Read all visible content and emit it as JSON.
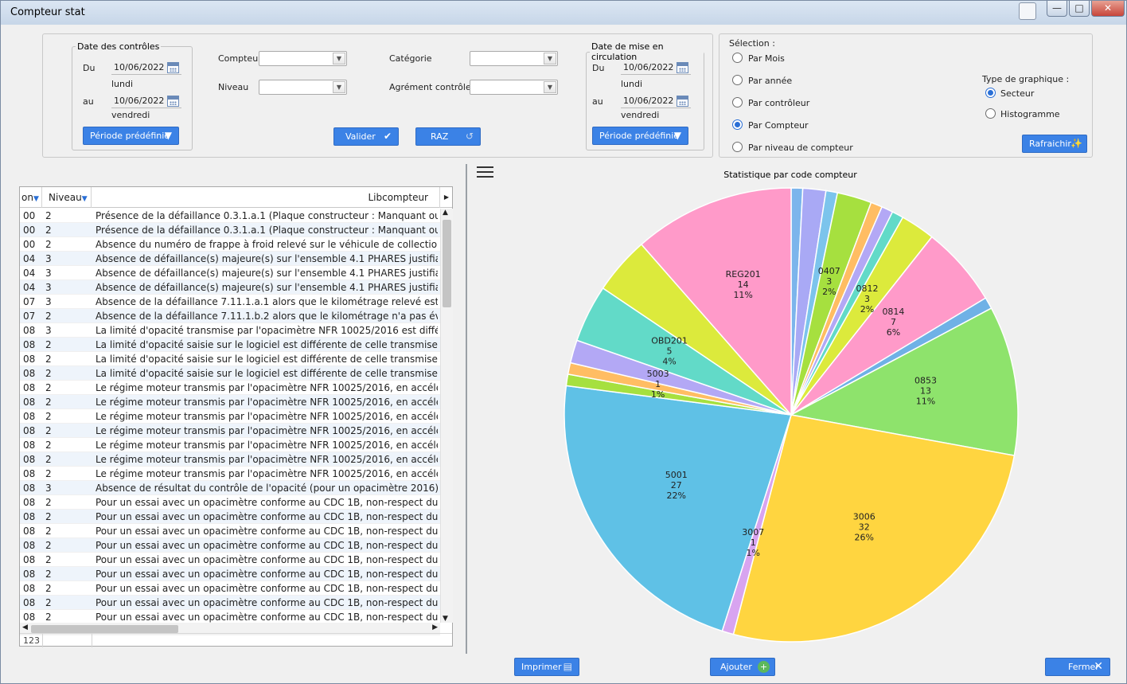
{
  "window": {
    "title": "Compteur stat",
    "controls": {
      "minimize": "—",
      "maximize": "□",
      "close": "✕"
    }
  },
  "filters": {
    "date_controles": {
      "legend": "Date des contrôles",
      "du_label": "Du",
      "du_value": "10/06/2022",
      "du_day": "lundi",
      "au_label": "au",
      "au_value": "10/06/2022",
      "au_day": "vendredi",
      "periode_button": "Période prédéfinie"
    },
    "compteur_label": "Compteur",
    "compteur_value": "",
    "niveau_label": "Niveau",
    "niveau_value": "",
    "categorie_label": "Catégorie",
    "categorie_value": "",
    "agrement_label": "Agrément contrôleur",
    "agrement_value": "",
    "valider_button": "Valider",
    "raz_button": "RAZ",
    "date_circulation": {
      "legend": "Date de mise en circulation",
      "du_label": "Du",
      "du_value": "10/06/2022",
      "du_day": "lundi",
      "au_label": "au",
      "au_value": "10/06/2022",
      "au_day": "vendredi",
      "periode_button": "Période prédéfinie"
    }
  },
  "selection": {
    "label": "Sélection  :",
    "options": [
      "Par Mois",
      "Par année",
      "Par contrôleur",
      "Par Compteur",
      "Par niveau de compteur"
    ],
    "selected": "Par Compteur",
    "chart_type_label": "Type de graphique :",
    "chart_types": [
      "Secteur",
      "Histogramme"
    ],
    "chart_type_selected": "Secteur",
    "refresh_button": "Rafraichir"
  },
  "grid": {
    "columns": [
      "on",
      "Niveau",
      "Libcompteur"
    ],
    "rows": [
      [
        "00",
        "2",
        "Présence de la défaillance 0.3.1.a.1 (Plaque constructeur : Manquant ou"
      ],
      [
        "00",
        "2",
        "Présence de la défaillance 0.3.1.a.1 (Plaque constructeur : Manquant ou"
      ],
      [
        "00",
        "2",
        "Absence du numéro de frappe à froid relevé sur le véhicule de collection e"
      ],
      [
        "04",
        "3",
        "Absence de défaillance(s) majeure(s) sur l'ensemble 4.1 PHARES justifian"
      ],
      [
        "04",
        "3",
        "Absence de défaillance(s) majeure(s) sur l'ensemble 4.1 PHARES justifian"
      ],
      [
        "04",
        "3",
        "Absence de défaillance(s) majeure(s) sur l'ensemble 4.1 PHARES justifian"
      ],
      [
        "07",
        "3",
        "Absence de la défaillance 7.11.1.a.1 alors que le kilométrage relevé est i"
      ],
      [
        "07",
        "2",
        "Absence de la défaillance 7.11.1.b.2 alors que le kilométrage n'a pas évol"
      ],
      [
        "08",
        "3",
        "La limité d'opacité transmise par l'opacimètre NFR 10025/2016 est différe"
      ],
      [
        "08",
        "2",
        "La limité d'opacité saisie sur le logiciel est différente de celle transmise p"
      ],
      [
        "08",
        "2",
        "La limité d'opacité saisie sur le logiciel est différente de celle transmise p"
      ],
      [
        "08",
        "2",
        "La limité d'opacité saisie sur le logiciel est différente de celle transmise p"
      ],
      [
        "08",
        "2",
        "Le régime moteur transmis par l'opacimètre NFR 10025/2016, en accéléra"
      ],
      [
        "08",
        "2",
        "Le régime moteur transmis par l'opacimètre NFR 10025/2016, en accéléra"
      ],
      [
        "08",
        "2",
        "Le régime moteur transmis par l'opacimètre NFR 10025/2016, en accéléra"
      ],
      [
        "08",
        "2",
        "Le régime moteur transmis par l'opacimètre NFR 10025/2016, en accéléra"
      ],
      [
        "08",
        "2",
        "Le régime moteur transmis par l'opacimètre NFR 10025/2016, en accéléra"
      ],
      [
        "08",
        "2",
        "Le régime moteur transmis par l'opacimètre NFR 10025/2016, en accéléra"
      ],
      [
        "08",
        "2",
        "Le régime moteur transmis par l'opacimètre NFR 10025/2016, en accéléra"
      ],
      [
        "08",
        "3",
        "Absence de résultat du contrôle de l'opacité (pour un opacimètre 2016) ou"
      ],
      [
        "08",
        "2",
        "Pour un essai avec un opacimètre conforme au CDC 1B, non-respect du ré"
      ],
      [
        "08",
        "2",
        "Pour un essai avec un opacimètre conforme au CDC 1B, non-respect du ré"
      ],
      [
        "08",
        "2",
        "Pour un essai avec un opacimètre conforme au CDC 1B, non-respect du ré"
      ],
      [
        "08",
        "2",
        "Pour un essai avec un opacimètre conforme au CDC 1B, non-respect du ré"
      ],
      [
        "08",
        "2",
        "Pour un essai avec un opacimètre conforme au CDC 1B, non-respect du ré"
      ],
      [
        "08",
        "2",
        "Pour un essai avec un opacimètre conforme au CDC 1B, non-respect du ré"
      ],
      [
        "08",
        "2",
        "Pour un essai avec un opacimètre conforme au CDC 1B, non-respect du ré"
      ],
      [
        "08",
        "2",
        "Pour un essai avec un opacimètre conforme au CDC 1B, non-respect du ré"
      ],
      [
        "08",
        "2",
        "Pour un essai avec un opacimètre conforme au CDC 1B, non-respect du ré"
      ]
    ],
    "footer_count": "123"
  },
  "chart_data": {
    "type": "pie",
    "title": "Statistique par code compteur",
    "slices": [
      {
        "label": "",
        "value": 1,
        "percent": "",
        "color": "#7cb5ec"
      },
      {
        "label": "",
        "value": 2,
        "percent": "",
        "color": "#a9a9f5"
      },
      {
        "label": "",
        "value": 1,
        "percent": "",
        "color": "#7cc4ec"
      },
      {
        "label": "0407",
        "value": 3,
        "percent": "2%",
        "color": "#a6e03f"
      },
      {
        "label": "",
        "value": 1,
        "percent": "",
        "color": "#ffbd63"
      },
      {
        "label": "",
        "value": 1,
        "percent": "",
        "color": "#b3a8f5"
      },
      {
        "label": "",
        "value": 1,
        "percent": "",
        "color": "#62dac8"
      },
      {
        "label": "0812",
        "value": 3,
        "percent": "2%",
        "color": "#dcea3c"
      },
      {
        "label": "0814",
        "value": 7,
        "percent": "6%",
        "color": "#ff9ac9"
      },
      {
        "label": "",
        "value": 1,
        "percent": "",
        "color": "#6fb1e6"
      },
      {
        "label": "0853",
        "value": 13,
        "percent": "11%",
        "color": "#8ee36c"
      },
      {
        "label": "3006",
        "value": 32,
        "percent": "26%",
        "color": "#ffd540"
      },
      {
        "label": "3007",
        "value": 1,
        "percent": "1%",
        "color": "#d8a4f0"
      },
      {
        "label": "5001",
        "value": 27,
        "percent": "22%",
        "color": "#5fc1e6"
      },
      {
        "label": "",
        "value": 1,
        "percent": "",
        "color": "#a6e03f"
      },
      {
        "label": "5003",
        "value": 1,
        "percent": "1%",
        "color": "#ffbd63"
      },
      {
        "label": "",
        "value": 2,
        "percent": "",
        "color": "#b3a8f5"
      },
      {
        "label": "OBD201",
        "value": 5,
        "percent": "4%",
        "color": "#62dac8"
      },
      {
        "label": "",
        "value": 5,
        "percent": "",
        "color": "#dcea3c"
      },
      {
        "label": "REG201",
        "value": 14,
        "percent": "11%",
        "color": "#ff9ac9"
      }
    ]
  },
  "bottom": {
    "print_button": "Imprimer",
    "add_button": "Ajouter",
    "close_button": "Fermer"
  }
}
